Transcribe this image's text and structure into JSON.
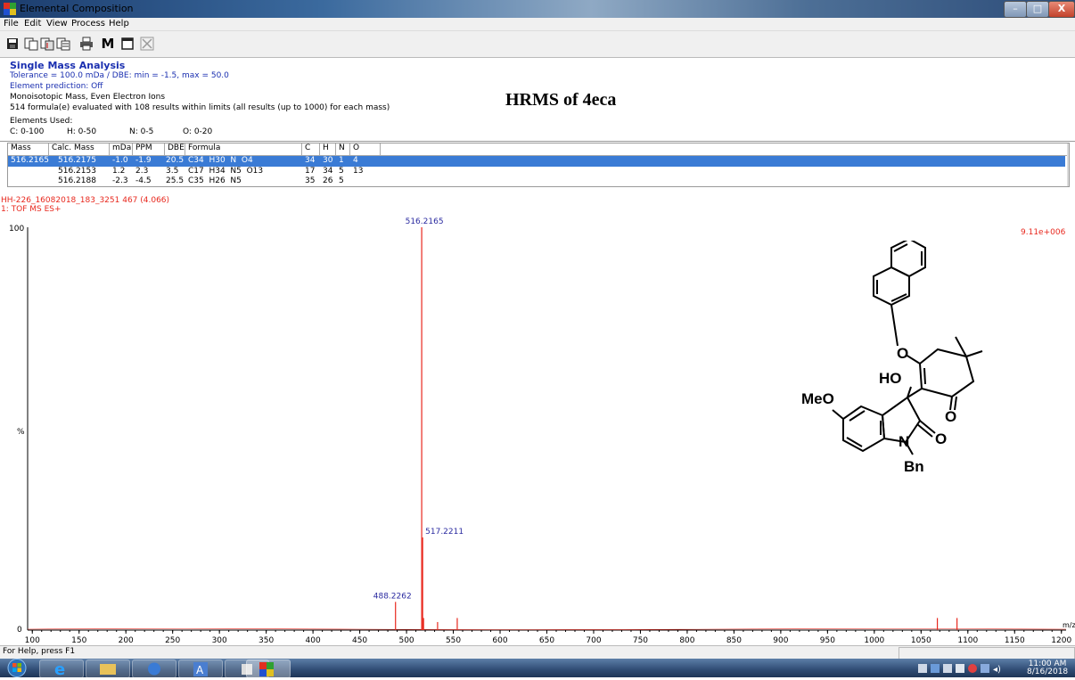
{
  "window": {
    "title": "Elemental Composition",
    "min_label": "–",
    "max_label": "□",
    "close_label": "X"
  },
  "menu": [
    "File",
    "Edit",
    "View",
    "Process",
    "Help"
  ],
  "toolbar": {
    "icons": [
      "save-icon",
      "copy-icon",
      "copy-spectrum-icon",
      "copy-table-icon",
      "print-icon",
      "mass-icon",
      "window-icon",
      "close-icon"
    ],
    "m_label": "M"
  },
  "analysis": {
    "heading": "Single Mass Analysis",
    "tolerance": "Tolerance = 100.0 mDa   /   DBE: min = -1.5, max = 50.0",
    "element_prediction": "Element prediction: Off",
    "mass_mode": "Monoisotopic Mass, Even Electron Ions",
    "evaluation": "514 formula(e) evaluated with 108 results within limits (all results (up to 1000) for each mass)",
    "elements_used_label": "Elements Used:",
    "elements": [
      "C: 0-100",
      "H: 0-50",
      "N: 0-5",
      "O: 0-20"
    ]
  },
  "annotation": "HRMS of 4eca",
  "table": {
    "headers": [
      "Mass",
      "Calc. Mass",
      "mDa",
      "PPM",
      "DBE",
      "Formula",
      "C",
      "H",
      "N",
      "O"
    ],
    "rows": [
      {
        "mass": "516.2165",
        "calc": "516.2175",
        "mda": "-1.0",
        "ppm": "-1.9",
        "dbe": "20.5",
        "formula": "C34  H30  N  O4",
        "c": "34",
        "h": "30",
        "n": "1",
        "o": "4"
      },
      {
        "mass": "",
        "calc": "516.2153",
        "mda": "1.2",
        "ppm": "2.3",
        "dbe": "3.5",
        "formula": "C17  H34  N5  O13",
        "c": "17",
        "h": "34",
        "n": "5",
        "o": "13"
      },
      {
        "mass": "",
        "calc": "516.2188",
        "mda": "-2.3",
        "ppm": "-4.5",
        "dbe": "25.5",
        "formula": "C35  H26  N5",
        "c": "35",
        "h": "26",
        "n": "5",
        "o": ""
      }
    ]
  },
  "spectrum": {
    "file_label": "HH-226_16082018_183_3251 467 (4.066)",
    "scan_label": "1: TOF MS ES+",
    "intensity_label": "9.11e+006",
    "y_top": "100",
    "y_mid": "%",
    "y_zero": "0",
    "x_unit": "m/z"
  },
  "structure_labels": {
    "o_ether": "O",
    "ho": "HO",
    "meo": "MeO",
    "o_ketone": "O",
    "n": "N",
    "o_lactam": "O",
    "bn": "Bn"
  },
  "status_bar": {
    "text": "For Help, press F1"
  },
  "taskbar": {
    "clock_time": "11:00 AM",
    "clock_date": "8/16/2018"
  },
  "colors": {
    "title_blue": "#1a2fb0",
    "spectrum_red": "#e8281e",
    "label_blue": "#2a2aa0",
    "selection_blue": "#3a7bd5"
  },
  "chart_data": {
    "type": "line",
    "title": "",
    "xlabel": "m/z",
    "ylabel": "%",
    "xlim": [
      95,
      1205
    ],
    "ylim": [
      0,
      100
    ],
    "x_ticks": [
      100,
      150,
      200,
      250,
      300,
      350,
      400,
      450,
      500,
      550,
      600,
      650,
      700,
      750,
      800,
      850,
      900,
      950,
      1000,
      1050,
      1100,
      1150,
      1200
    ],
    "peaks": [
      {
        "mz": 488.2262,
        "intensity": 7,
        "label": "488.2262"
      },
      {
        "mz": 516.2165,
        "intensity": 100,
        "label": "516.2165"
      },
      {
        "mz": 517.2211,
        "intensity": 23,
        "label": "517.2211"
      },
      {
        "mz": 518.22,
        "intensity": 3,
        "label": ""
      },
      {
        "mz": 533.2,
        "intensity": 2,
        "label": ""
      },
      {
        "mz": 554.2,
        "intensity": 3,
        "label": ""
      },
      {
        "mz": 1067.4,
        "intensity": 3,
        "label": ""
      },
      {
        "mz": 1088.4,
        "intensity": 3,
        "label": ""
      }
    ]
  }
}
